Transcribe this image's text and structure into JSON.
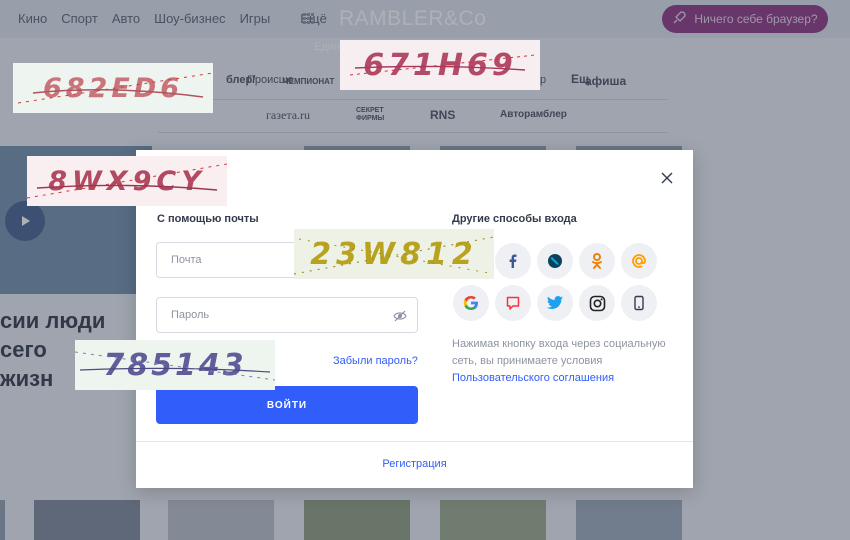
{
  "topnav": [
    "Кино",
    "Спорт",
    "Авто",
    "Шоу-бизнес",
    "Игры",
    "Ещё"
  ],
  "logo": "RAMBLER&Co",
  "browser_button": "Ничего себе браузер?",
  "subtitle": "Един",
  "partners": {
    "row1": [
      "блер/",
      "Происше",
      "ЧЕМПИОНАТ",
      "р",
      "Ещ",
      "афиша"
    ],
    "row2": [
      "газета.ru",
      "СЕКРЕТ ФИРМЫ",
      "RNS",
      "Авторамблер"
    ]
  },
  "headline": [
    "сии люди",
    "сего",
    "жизн"
  ],
  "modal": {
    "email_section_title": "С помощью почты",
    "email_placeholder": "Почта",
    "password_placeholder": "Пароль",
    "forgot_password": "Забыли пароль?",
    "login_button": "ВОЙТИ",
    "other_section_title": "Другие способы входа",
    "social_buttons": [
      "facebook-icon",
      "livejournal-icon",
      "odnoklassniki-icon",
      "mail-at-icon",
      "google-icon",
      "mymail-icon",
      "twitter-icon",
      "instagram-icon",
      "phone-icon"
    ],
    "agreement_text": "Нажимая кнопку входа через социальную сеть, вы принимаете условия",
    "agreement_link": "Пользовательского соглашения",
    "register_link": "Регистрация"
  },
  "captchas": [
    "682ED6",
    "671H69",
    "8WX9CY",
    "23W812",
    "785143"
  ],
  "colors": {
    "accent": "#315efb",
    "browser_button": "#8a2e7a",
    "facebook": "#3b5998",
    "ok": "#ee8208",
    "twitter": "#1da1f2"
  }
}
